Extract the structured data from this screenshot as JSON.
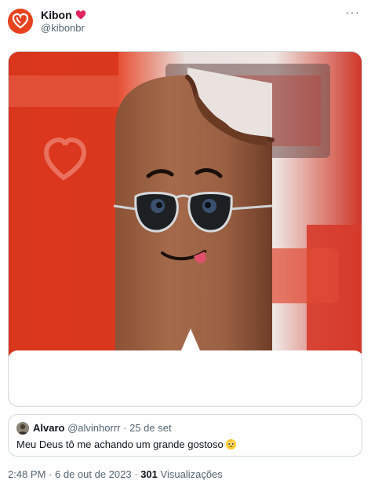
{
  "author": {
    "name": "Kibon",
    "handle": "@kibonbr",
    "avatar_icon": "kibon-heart-logo",
    "badge_icon": "red-heart-icon",
    "brand_color": "#e8421f"
  },
  "menu_icon": "more-options-icon",
  "quote": {
    "name": "Alvaro",
    "handle": "@alvinhorrr",
    "separator": "·",
    "date": "25 de set",
    "text": "Meu Deus tô me achando um grande gostoso",
    "emoji_icon": "pleading-face-emoji"
  },
  "footer": {
    "time": "2:48 PM",
    "separator": "·",
    "date": "6 de out de 2023",
    "views_count": "301",
    "views_label": "Visualizações"
  }
}
